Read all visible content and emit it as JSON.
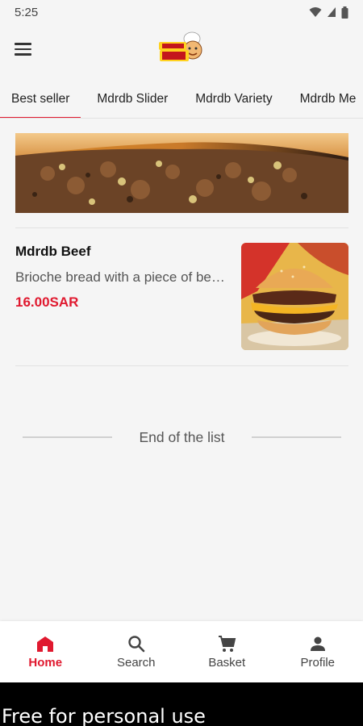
{
  "status": {
    "time": "5:25"
  },
  "app": {
    "logo_text_top": "mdrdb",
    "logo_text_bottom": "house"
  },
  "tabs": [
    {
      "label": "Best seller",
      "active": true
    },
    {
      "label": "Mdrdb Slider",
      "active": false
    },
    {
      "label": "Mdrdb Variety",
      "active": false
    },
    {
      "label": "Mdrdb Me",
      "active": false
    }
  ],
  "products": [
    {
      "name": "Mdrdb Beef",
      "description": "Brioche bread with a piece of beef patty, cheese and caramelized onion",
      "price": "16.00SAR"
    }
  ],
  "list_end": {
    "label": "End of the list"
  },
  "bottom_nav": {
    "home": "Home",
    "search": "Search",
    "basket": "Basket",
    "profile": "Profile"
  },
  "watermark": "Free for personal use",
  "colors": {
    "accent": "#e0192f",
    "background": "#f5f5f5"
  }
}
